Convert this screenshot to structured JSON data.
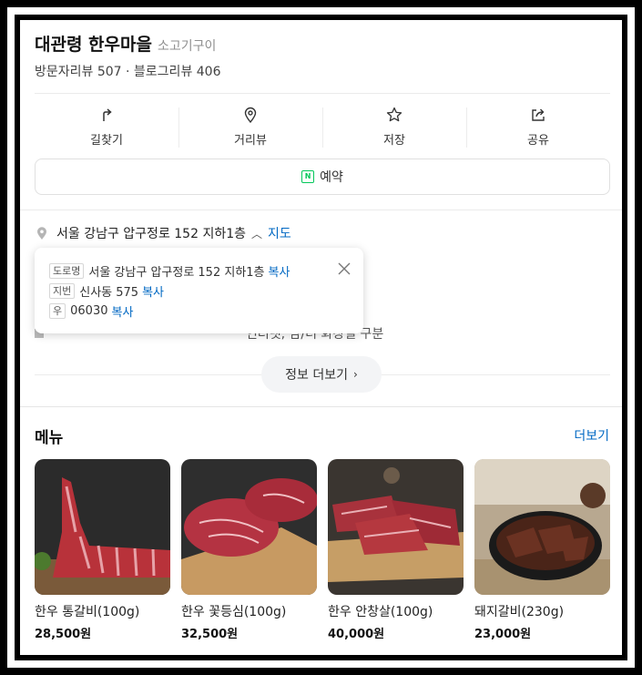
{
  "place": {
    "name": "대관령 한우마을",
    "category": "소고기구이",
    "reviews": "방문자리뷰 507 · 블로그리뷰 406"
  },
  "actions": [
    {
      "label": "길찾기",
      "icon": "directions-icon"
    },
    {
      "label": "거리뷰",
      "icon": "street-view-icon"
    },
    {
      "label": "저장",
      "icon": "star-icon"
    },
    {
      "label": "공유",
      "icon": "share-icon"
    }
  ],
  "reserve": {
    "label": "예약",
    "icon_text": "N"
  },
  "address": {
    "text": "서울 강남구 압구정로 152 지하1층",
    "map_link": "지도",
    "popup": {
      "road_tag": "도로명",
      "road": "서울 강남구 압구정로 152 지하1층",
      "lot_tag": "지번",
      "lot": "신사동 575",
      "zip_tag": "우",
      "zip": "06030",
      "copy_label": "복사"
    }
  },
  "amenities_partial": "인터넷, 남/녀 화장실 구분",
  "more_info": "정보 더보기",
  "menu": {
    "title": "메뉴",
    "more": "더보기",
    "items": [
      {
        "name": "한우 통갈비(100g)",
        "price": "28,500원"
      },
      {
        "name": "한우 꽃등심(100g)",
        "price": "32,500원"
      },
      {
        "name": "한우 안창살(100g)",
        "price": "40,000원"
      },
      {
        "name": "돼지갈비(230g)",
        "price": "23,000원"
      }
    ]
  },
  "colors": {
    "link": "#0068c3",
    "naver_green": "#03c75a"
  }
}
